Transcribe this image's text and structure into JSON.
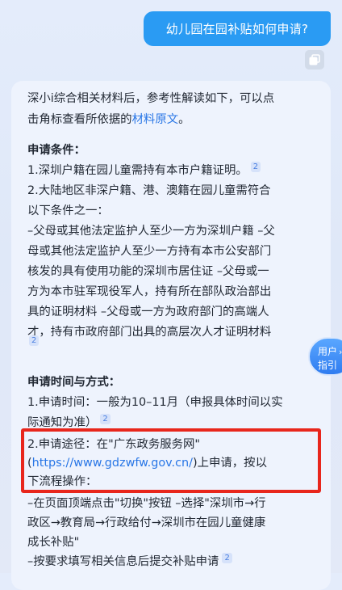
{
  "user_message": "幼儿园在园补贴如何申请?",
  "answer": {
    "intro_line1": "深小i综合相关材料后，参考性解读如下，可以点",
    "intro_line2_prefix": "击角标查看所依据的",
    "intro_link": "材料原文",
    "intro_line2_suffix": "。",
    "section1_title": "申请条件：",
    "cond1": "1.深圳户籍在园儿童需持有本市户籍证明。",
    "cond2_line1": "2.大陆地区非深户籍、港、澳籍在园儿童需符合",
    "cond2_line2": "以下条件之一：",
    "cond2_line3": "–父母或其他法定监护人至少一方为深圳户籍 –父",
    "cond2_line4": "母或其他法定监护人至少一方持有本市公安部门",
    "cond2_line5": "核发的具有使用功能的深圳市居住证 –父母或一",
    "cond2_line6": "方为本市驻军现役军人，持有所在部队政治部出",
    "cond2_line7": "具的证明材料 –父母或一方为政府部门的高端人",
    "cond2_line8": "才，持有市政府部门出具的高层次人才证明材料",
    "section2_title": "申请时间与方式：",
    "time_line1": "1.申请时间：一般为10–11月（申报具体时间以实",
    "time_line2": "际通知为准）",
    "way_line1": "2.申请途径：在\"广东政务服务网\"",
    "way_line2_prefix": "(",
    "way_link": "https://www.gdzwfw.gov.cn/",
    "way_line2_suffix": ")上申请，按以",
    "way_line3": "下流程操作：",
    "step_line1": "–在页面顶端点击\"切换\"按钮 –选择\"深圳市→行",
    "step_line2": "政区→教育局→行政给付→深圳市在园儿童健康",
    "step_line3": "成长补贴\"",
    "step_line4": "–按要求填写相关信息后提交补贴申请",
    "ref_num": "2"
  },
  "side_button": {
    "line1": "用户",
    "line2": "指引"
  },
  "icons": {
    "copy": "copy-icon",
    "chevron": "chevron-right-icon"
  },
  "colors": {
    "accent": "#2a9bf3",
    "link": "#2876e6",
    "highlight": "#e8261c"
  }
}
